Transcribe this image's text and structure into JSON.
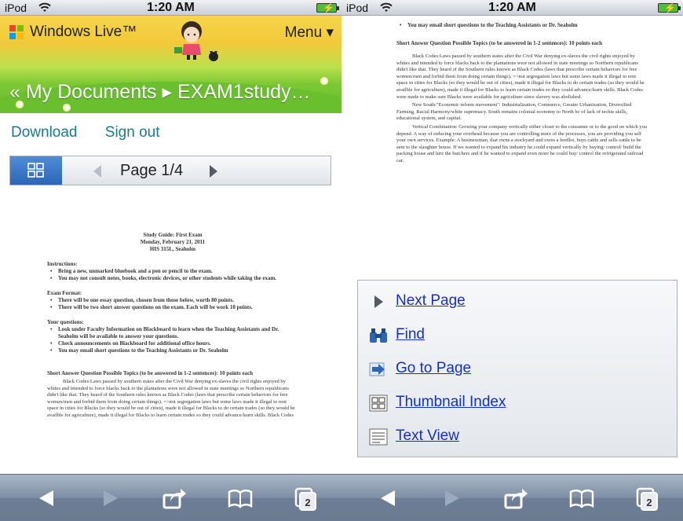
{
  "left": {
    "status": {
      "carrier": "iPod",
      "time": "1:20 AM"
    },
    "header": {
      "brand": "Windows Live™",
      "menu": "Menu ▾",
      "breadcrumb": "« My Documents ▸ EXAM1study…"
    },
    "links": {
      "download": "Download",
      "signout": "Sign out"
    },
    "pager": {
      "page_label": "Page 1/4"
    },
    "document": {
      "title1": "Study Guide: First Exam",
      "title2": "Monday, February 21, 2011",
      "title3": "HIS 315L, Seaholm",
      "instructions_heading": "Instructions:",
      "instructions": [
        "Bring a new, unmarked bluebook and a pen or pencil to the exam.",
        "You may not consult notes, books, electronic devices, or other students while taking the exam."
      ],
      "format_heading": "Exam Format:",
      "format": [
        "There will be one essay question, chosen from those below, worth 80 points.",
        "There will be two short answer questions on the exam. Each will be work 10 points."
      ],
      "questions_heading": "Your questions:",
      "questions": [
        "Look under Faculty Information on Blackboard to learn when the Teaching Assistants and Dr. Seaholm will be available to answer your questions.",
        "Check announcements on Blackboard for additional office hours.",
        "You may email short questions to the Teaching Assistants or Dr. Seaholm"
      ],
      "short_heading": "Short Answer Question Possible Topics (to be answered in 1-2 sentences):  10 points each",
      "short_text": "Black Codes:Laws passed by southern states after the Civil War denying ex-slaves the civil rights enjoyed by whites and intended to force blacks back to the plantations were not allowed in state meetings so Northern republicans didn't like that. They heard of the Southern rules known as Black Codes (laws that prescribe certain behaviors for free women/men and forbid them from doing certain things). =>not segregation laws but some laws made it illegal to rent space in cities for Blacks (so they would be out of cities), made it illegal for Blacks to do certain trades (so they would be availble for agriculture), made it illegal for Blacks to learn certain trades so they could advance/learn skills. Black Codes"
    },
    "toolbar": {
      "pages_count": "2"
    }
  },
  "right": {
    "status": {
      "carrier": "iPod",
      "time": "1:20 AM"
    },
    "document": {
      "top_item": "You may email short questions to the Teaching Assistants or Dr. Seaholm",
      "short_heading": "Short Answer Question Possible Topics (to be answered in 1-2 sentences):  10 points each",
      "p1": "Black Codes:Laws passed by southern states after the Civil War denying ex-slaves the civil rights enjoyed by whites and intended to force blacks back to the plantations were not allowed in state meetings so Northern republicans didn't like that. They heard of the Southern rules known as Black Codes (laws that prescribe certain behaviors for free women/men and forbid them from doing certain things). =>not segregation laws but some laws made it illegal to rent space in cities for Blacks (so they would be out of cities), made it illegal for Blacks to do certain trades (so they would be availble for agriculture), made it illegal for Blacks to learn certain trades so they could advance/learn skills. Black Codes were made to make sure Blacks were available for agriculture since slavery was abolished.",
      "p2": "New South:\"Economic reform movement\": Industrialization, Commerce, Greater Urbanization, Diversified Farming, Racial Harmony/white supremacy.          South remains colonial economy to North bc of lack of techie skills, educational system, and capital.",
      "p3": "Vertical Combination: Growing your company vertically either closer to the consumer or to the good on which you depend. A way of reducing your overhead because you are controlling more of the processes, you are providing you self your own services. Example: A businessman, that owns a stockyard and owns a feedlot, buys cattle and sells cattle to be sent to the slaughter house. If we wanted to expand his industry he could expand vertically by buying/ control/ build the packing house and hire the butchers and if he wanted to expand even more he could buy/ control the refrigerated railroad car."
    },
    "menu": {
      "next_page": "Next Page",
      "find": "Find",
      "go_to_page": "Go to Page",
      "thumbnail_index": "Thumbnail Index",
      "text_view": "Text View"
    },
    "toolbar": {
      "pages_count": "2"
    }
  },
  "colors": {
    "link_teal": "#1a7a8f",
    "menu_link_blue": "#1530c8",
    "toolbar_blue": "#7e8ea5",
    "thumb_button_blue": "#2c66b5"
  }
}
